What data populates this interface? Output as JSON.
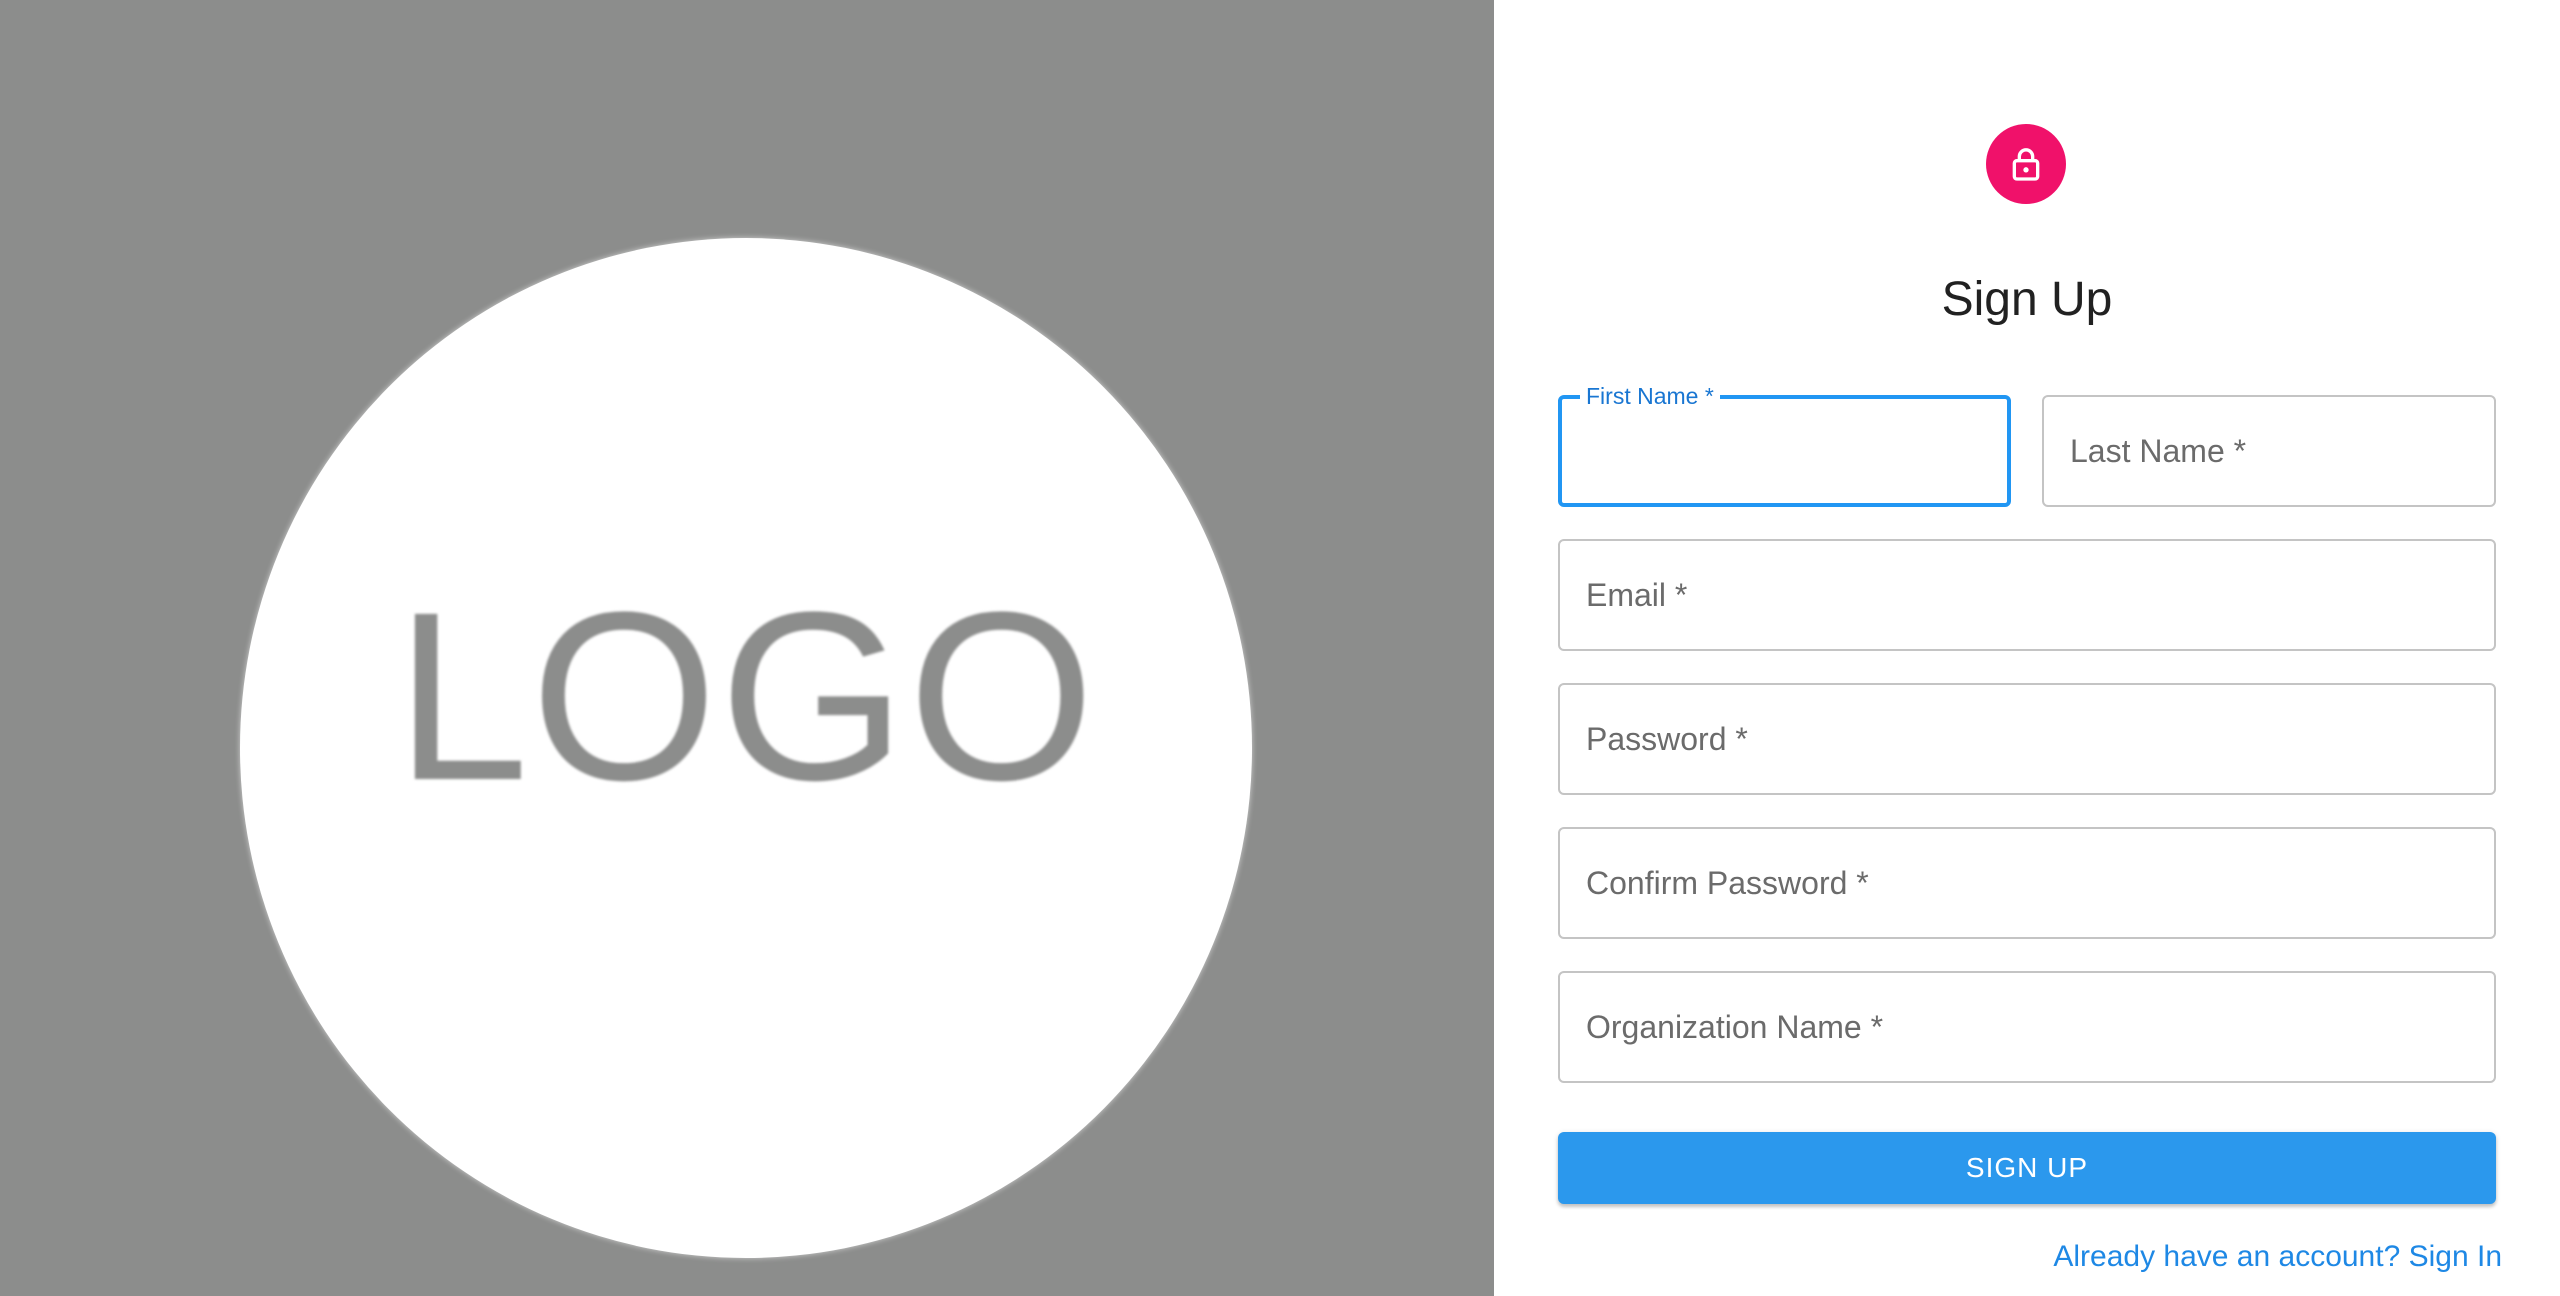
{
  "hero": {
    "logo_text": "LOGO",
    "background_color": "#8c8d8c"
  },
  "form": {
    "icon": "lock-icon",
    "accent_color": "#f0116a",
    "title": "Sign Up",
    "fields": {
      "first_name": {
        "label": "First Name *",
        "value": ""
      },
      "last_name": {
        "label": "Last Name *",
        "value": ""
      },
      "email": {
        "label": "Email *",
        "value": ""
      },
      "password": {
        "label": "Password *",
        "value": ""
      },
      "confirm_password": {
        "label": "Confirm Password *",
        "value": ""
      },
      "organization_name": {
        "label": "Organization Name *",
        "value": ""
      }
    },
    "submit_label": "SIGN UP",
    "button_color": "#2b98ed",
    "signin_link": "Already have an account? Sign In"
  }
}
